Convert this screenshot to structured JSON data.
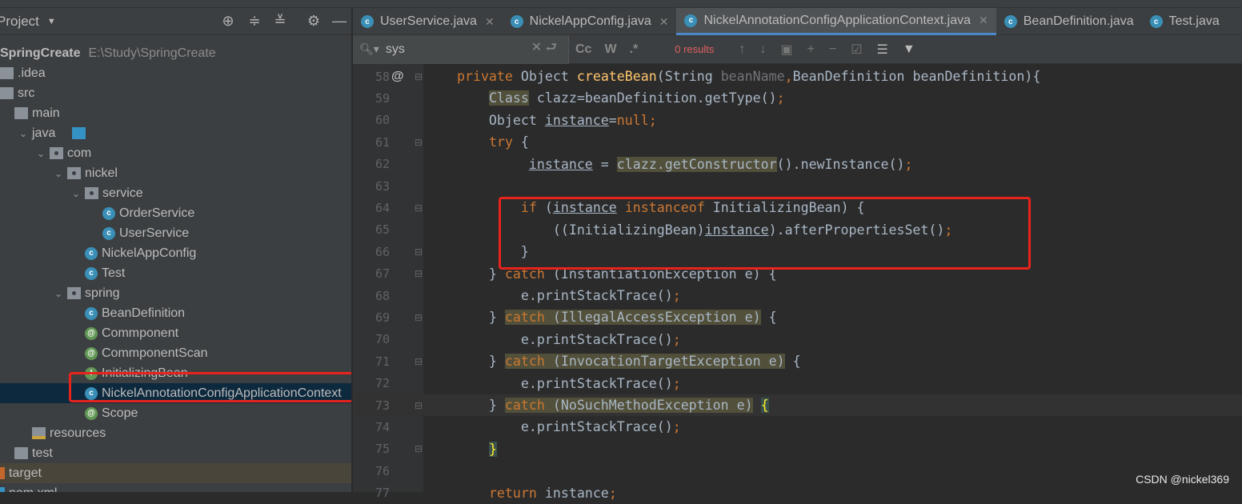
{
  "project_panel": {
    "title": "Project",
    "tree": [
      {
        "label": "SpringCreate",
        "path": "E:\\Study\\SpringCreate",
        "icon": "module-icon",
        "depth": -1,
        "bold": true
      },
      {
        "label": ".idea",
        "icon": "folder-icon",
        "depth": 0
      },
      {
        "label": "src",
        "icon": "folder-icon",
        "depth": 0
      },
      {
        "label": "main",
        "icon": "folder-icon",
        "depth": 1
      },
      {
        "label": "java",
        "icon": "source-folder-icon",
        "depth": 2,
        "expanded": true
      },
      {
        "label": "com",
        "icon": "package-icon",
        "depth": 3,
        "expanded": true
      },
      {
        "label": "nickel",
        "icon": "package-icon",
        "depth": 4,
        "expanded": true
      },
      {
        "label": "service",
        "icon": "package-icon",
        "depth": 5,
        "expanded": true
      },
      {
        "label": "OrderService",
        "icon": "class-icon",
        "depth": 6
      },
      {
        "label": "UserService",
        "icon": "class-icon",
        "depth": 6
      },
      {
        "label": "NickelAppConfig",
        "icon": "class-icon",
        "depth": 5
      },
      {
        "label": "Test",
        "icon": "runnable-class-icon",
        "depth": 5
      },
      {
        "label": "spring",
        "icon": "package-icon",
        "depth": 4,
        "expanded": true
      },
      {
        "label": "BeanDefinition",
        "icon": "class-icon",
        "depth": 5
      },
      {
        "label": "Commponent",
        "icon": "annotation-icon",
        "depth": 5
      },
      {
        "label": "CommponentScan",
        "icon": "annotation-icon",
        "depth": 5
      },
      {
        "label": "InitializingBean",
        "icon": "interface-icon",
        "depth": 5
      },
      {
        "label": "NickelAnnotationConfigApplicationContext",
        "icon": "class-icon",
        "depth": 5,
        "selected": true
      },
      {
        "label": "Scope",
        "icon": "annotation-icon",
        "depth": 5
      },
      {
        "label": "resources",
        "icon": "resources-folder-icon",
        "depth": 2
      },
      {
        "label": "test",
        "icon": "folder-icon",
        "depth": 1
      },
      {
        "label": "target",
        "icon": "excluded-folder-icon",
        "depth": 0,
        "excluded": true
      },
      {
        "label": "pom.xml",
        "icon": "maven-icon",
        "depth": 0
      }
    ]
  },
  "tabs": [
    {
      "label": "UserService.java",
      "active": false
    },
    {
      "label": "NickelAppConfig.java",
      "active": false
    },
    {
      "label": "NickelAnnotationConfigApplicationContext.java",
      "active": true
    },
    {
      "label": "BeanDefinition.java",
      "active": false
    },
    {
      "label": "Test.java",
      "active": false
    }
  ],
  "search": {
    "query": "sys",
    "match_case": "Cc",
    "words": "W",
    "regex": ".*",
    "results": "0 results"
  },
  "code": [
    {
      "n": "58",
      "at": true,
      "tokens": [
        [
          "    ",
          ""
        ],
        [
          "private ",
          "k"
        ],
        [
          "Object ",
          ""
        ],
        [
          "createBean",
          "f"
        ],
        [
          "(String ",
          ""
        ],
        [
          "beanName",
          "g"
        ],
        [
          ",",
          "k"
        ],
        [
          "BeanDefinition beanDefinition){",
          ""
        ]
      ]
    },
    {
      "n": "59",
      "tokens": [
        [
          "        ",
          ""
        ],
        [
          "Class",
          "h"
        ],
        [
          " clazz=beanDefinition.getType()",
          ""
        ],
        [
          ";",
          "k"
        ]
      ]
    },
    {
      "n": "60",
      "tokens": [
        [
          "        Object ",
          ""
        ],
        [
          "instance",
          "u"
        ],
        [
          "=",
          ""
        ],
        [
          "null;",
          "k"
        ]
      ]
    },
    {
      "n": "61",
      "tokens": [
        [
          "        ",
          ""
        ],
        [
          "try ",
          "k"
        ],
        [
          "{",
          ""
        ]
      ]
    },
    {
      "n": "62",
      "tokens": [
        [
          "             ",
          ""
        ],
        [
          "instance",
          "u"
        ],
        [
          " = ",
          ""
        ],
        [
          "clazz.getConstructor",
          "h"
        ],
        [
          "().newInstance()",
          ""
        ],
        [
          ";",
          "k"
        ]
      ]
    },
    {
      "n": "63",
      "tokens": []
    },
    {
      "n": "64",
      "tokens": [
        [
          "            ",
          ""
        ],
        [
          "if ",
          "k"
        ],
        [
          "(",
          ""
        ],
        [
          "instance",
          "u"
        ],
        [
          " ",
          ""
        ],
        [
          "instanceof ",
          "k"
        ],
        [
          "InitializingBean) {",
          ""
        ]
      ]
    },
    {
      "n": "65",
      "tokens": [
        [
          "                ((InitializingBean)",
          ""
        ],
        [
          "instance",
          "u"
        ],
        [
          ").afterPropertiesSet()",
          ""
        ],
        [
          ";",
          "k"
        ]
      ]
    },
    {
      "n": "66",
      "tokens": [
        [
          "            }",
          ""
        ]
      ]
    },
    {
      "n": "67",
      "tokens": [
        [
          "        } ",
          ""
        ],
        [
          "catch ",
          "k"
        ],
        [
          "(InstantiationException e) {",
          ""
        ]
      ]
    },
    {
      "n": "68",
      "tokens": [
        [
          "            e.printStackTrace()",
          ""
        ],
        [
          ";",
          "k"
        ]
      ]
    },
    {
      "n": "69",
      "tokens": [
        [
          "        } ",
          ""
        ],
        [
          "catch",
          "k h"
        ],
        [
          " (IllegalAccessException e)",
          "h"
        ],
        [
          " {",
          ""
        ]
      ]
    },
    {
      "n": "70",
      "tokens": [
        [
          "            e.printStackTrace()",
          ""
        ],
        [
          ";",
          "k"
        ]
      ]
    },
    {
      "n": "71",
      "tokens": [
        [
          "        } ",
          ""
        ],
        [
          "catch",
          "k h"
        ],
        [
          " (InvocationTargetException e)",
          "h"
        ],
        [
          " {",
          ""
        ]
      ]
    },
    {
      "n": "72",
      "tokens": [
        [
          "            e.printStackTrace()",
          ""
        ],
        [
          ";",
          "k"
        ]
      ]
    },
    {
      "n": "73",
      "current": true,
      "tokens": [
        [
          "        } ",
          ""
        ],
        [
          "catch",
          "k h"
        ],
        [
          " (NoSuchMethodException e)",
          "h"
        ],
        [
          " ",
          ""
        ],
        [
          "{",
          "y"
        ]
      ]
    },
    {
      "n": "74",
      "tokens": [
        [
          "            e.printStackTrace()",
          ""
        ],
        [
          ";",
          "k"
        ]
      ]
    },
    {
      "n": "75",
      "tokens": [
        [
          "        ",
          ""
        ],
        [
          "}",
          "y"
        ]
      ]
    },
    {
      "n": "76",
      "tokens": []
    },
    {
      "n": "77",
      "tokens": [
        [
          "        ",
          ""
        ],
        [
          "return ",
          "k"
        ],
        [
          "instance",
          ""
        ],
        [
          ";",
          "k"
        ]
      ]
    }
  ],
  "watermark": "CSDN @nickel369"
}
